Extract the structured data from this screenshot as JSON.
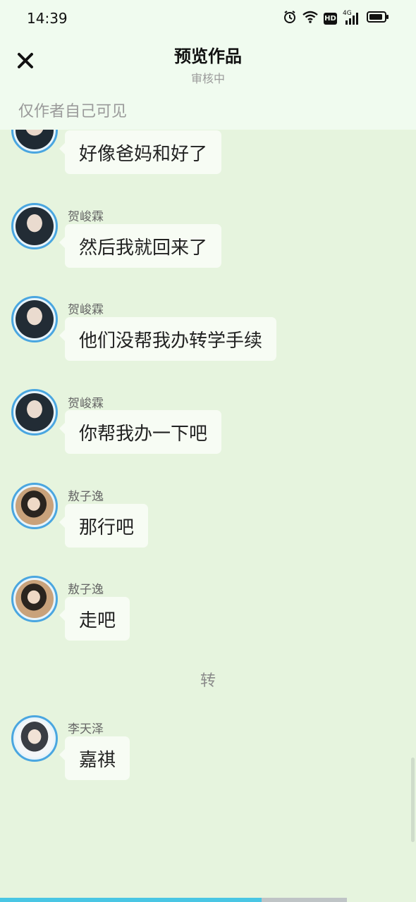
{
  "status_bar": {
    "time": "14:39",
    "hd_label": "HD",
    "network_label": "4G",
    "icons": [
      "alarm-icon",
      "wifi-icon",
      "hd-icon",
      "signal-icon",
      "battery-icon"
    ]
  },
  "header": {
    "title": "预览作品",
    "subtitle": "审核中",
    "visibility_note": "仅作者自己可见",
    "close_icon": "close-icon"
  },
  "messages": [
    {
      "sender": "",
      "text": "好像爸妈和好了"
    },
    {
      "sender": "贺峻霖",
      "text": "然后我就回来了"
    },
    {
      "sender": "贺峻霖",
      "text": "他们没帮我办转学手续"
    },
    {
      "sender": "贺峻霖",
      "text": "你帮我办一下吧"
    },
    {
      "sender": "敖子逸",
      "text": "那行吧"
    },
    {
      "sender": "敖子逸",
      "text": "走吧"
    },
    {
      "sender": "李天泽",
      "text": "嘉祺"
    }
  ],
  "separator": "转",
  "progress": {
    "fraction": 0.755
  },
  "colors": {
    "background": "#e6f4de",
    "header": "#f0fbef",
    "bubble": "#f7fcf4",
    "avatar_ring": "#4aa6e0",
    "progress": "#49c6e4"
  }
}
